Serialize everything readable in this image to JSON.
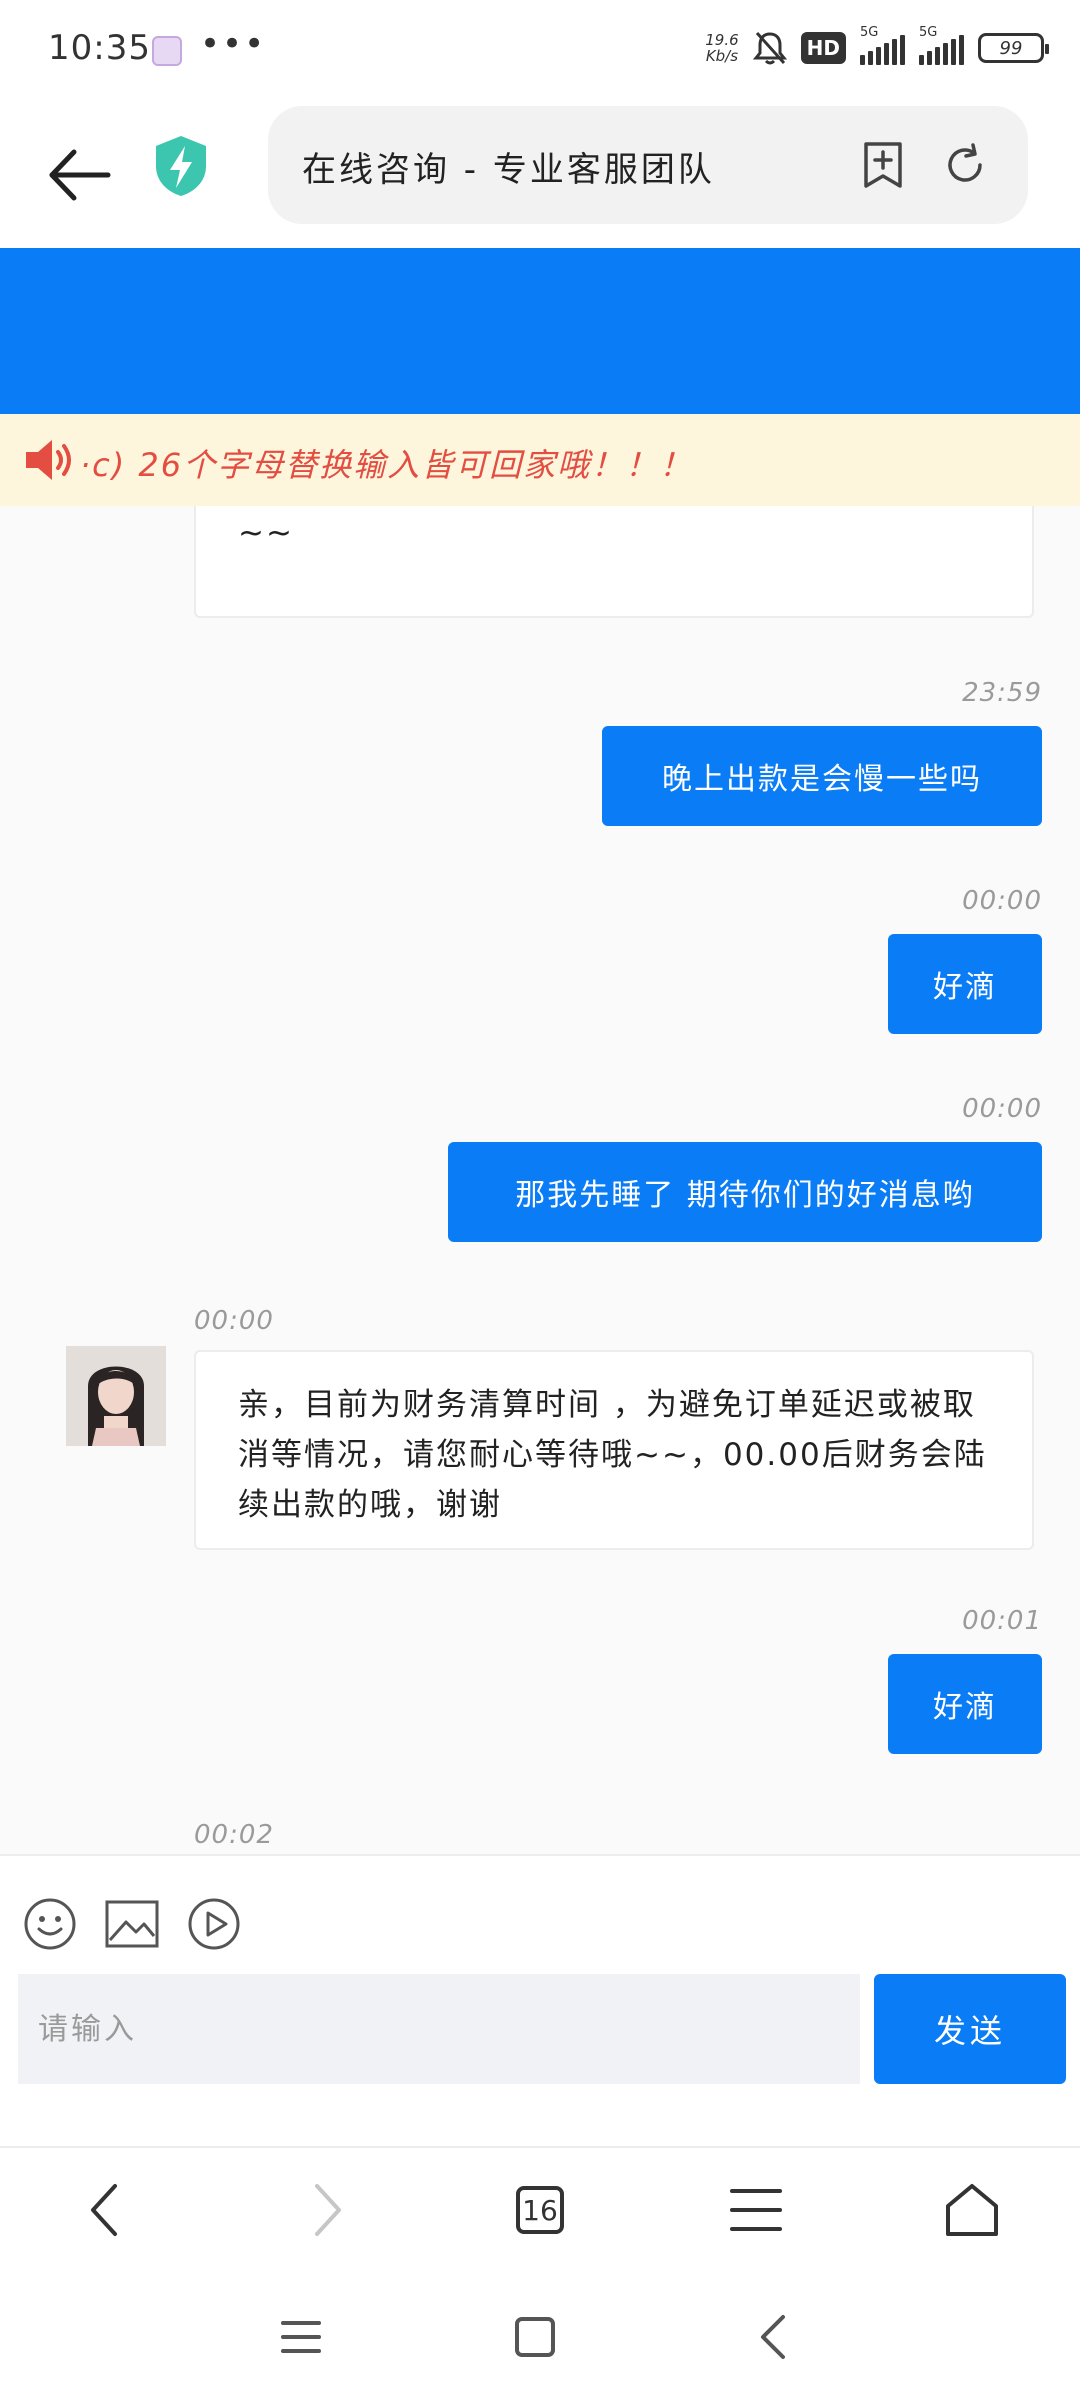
{
  "status_bar": {
    "time": "10:35",
    "more": "•••",
    "net_speed_value": "19.6",
    "net_speed_unit": "Kb/s",
    "hd_label": "HD",
    "signal_1_tag": "5G",
    "signal_2_tag": "5G",
    "battery": "99"
  },
  "header": {
    "url_title": "在线咨询 - 专业客服团队"
  },
  "announcement": {
    "text": "·c) 26个字母替换输入皆可回家哦！！！"
  },
  "chat": {
    "messages": [
      {
        "side": "left",
        "text": "一出款哦，给您带来不便，还请您多多见谅，谢谢~~"
      },
      {
        "side": "right",
        "time": "23:59",
        "text": "晚上出款是会慢一些吗"
      },
      {
        "side": "right",
        "time": "00:00",
        "text": "好滴"
      },
      {
        "side": "right",
        "time": "00:00",
        "text": "那我先睡了 期待你们的好消息哟"
      },
      {
        "side": "left",
        "time": "00:00",
        "text": "亲，目前为财务清算时间 ，为避免订单延迟或被取消等情况，请您耐心等待哦~~，00.00后财务会陆续出款的哦，谢谢"
      },
      {
        "side": "right",
        "time": "00:01",
        "text": "好滴"
      },
      {
        "side": "left",
        "time": "00:02",
        "text": ""
      }
    ]
  },
  "input": {
    "placeholder": "请输入",
    "send_label": "发送"
  },
  "browser_toolbar": {
    "tab_count": "16"
  },
  "colors": {
    "accent_blue": "#0a7cf6",
    "announcement_bg": "#fdf6dc",
    "announcement_text": "#e34d42",
    "shield": "#3cc6b0"
  }
}
